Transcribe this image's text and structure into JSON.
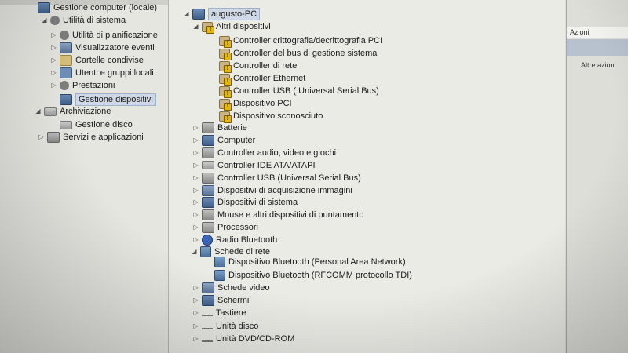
{
  "left_tree": {
    "items": [
      {
        "label": "Gestione computer (locale)",
        "icon": "computer-management-icon",
        "expander": ""
      },
      {
        "label": "Utilità di sistema",
        "icon": "tools-icon",
        "expander": "◢"
      },
      {
        "label": "Utilità di pianificazione",
        "icon": "clock-icon",
        "expander": "▷"
      },
      {
        "label": "Visualizzatore eventi",
        "icon": "event-viewer-icon",
        "expander": "▷"
      },
      {
        "label": "Cartelle condivise",
        "icon": "shared-folder-icon",
        "expander": "▷"
      },
      {
        "label": "Utenti e gruppi locali",
        "icon": "users-icon",
        "expander": "▷"
      },
      {
        "label": "Prestazioni",
        "icon": "performance-icon",
        "expander": "▷"
      },
      {
        "label": "Gestione dispositivi",
        "icon": "device-manager-icon",
        "expander": ""
      },
      {
        "label": "Archiviazione",
        "icon": "storage-icon",
        "expander": "◢"
      },
      {
        "label": "Gestione disco",
        "icon": "disk-icon",
        "expander": ""
      },
      {
        "label": "Servizi e applicazioni",
        "icon": "services-icon",
        "expander": "▷"
      }
    ]
  },
  "device_tree": {
    "root": "augusto-PC",
    "other_devices": {
      "label": "Altri dispositivi",
      "children": [
        "Controller crittografia/decrittografia PCI",
        "Controller del bus di gestione sistema",
        "Controller di rete",
        "Controller Ethernet",
        "Controller USB ( Universal Serial Bus)",
        "Dispositivo PCI",
        "Dispositivo sconosciuto"
      ]
    },
    "categories_a": [
      {
        "label": "Batterie",
        "icon": "battery-icon"
      },
      {
        "label": "Computer",
        "icon": "computer-icon"
      },
      {
        "label": "Controller audio, video e giochi",
        "icon": "speaker-icon"
      },
      {
        "label": "Controller IDE ATA/ATAPI",
        "icon": "ide-controller-icon"
      },
      {
        "label": "Controller USB (Universal Serial Bus)",
        "icon": "usb-icon"
      },
      {
        "label": "Dispositivi di acquisizione immagini",
        "icon": "camera-icon"
      },
      {
        "label": "Dispositivi di sistema",
        "icon": "system-device-icon"
      },
      {
        "label": "Mouse e altri dispositivi di puntamento",
        "icon": "mouse-icon"
      },
      {
        "label": "Processori",
        "icon": "processor-icon"
      },
      {
        "label": "Radio Bluetooth",
        "icon": "bluetooth-icon"
      }
    ],
    "network": {
      "label": "Schede di rete",
      "children": [
        "Dispositivo Bluetooth (Personal Area Network)",
        "Dispositivo Bluetooth (RFCOMM protocollo TDI)"
      ]
    },
    "categories_b": [
      {
        "label": "Schede video",
        "icon": "display-adapter-icon"
      },
      {
        "label": "Schermi",
        "icon": "monitor-icon"
      },
      {
        "label": "Tastiere",
        "icon": "keyboard-icon"
      },
      {
        "label": "Unità disco",
        "icon": "disk-drive-icon"
      },
      {
        "label": "Unità DVD/CD-ROM",
        "icon": "dvd-drive-icon"
      }
    ]
  },
  "actions_pane": {
    "header": "Azioni",
    "more_actions": "Altre azioni"
  }
}
